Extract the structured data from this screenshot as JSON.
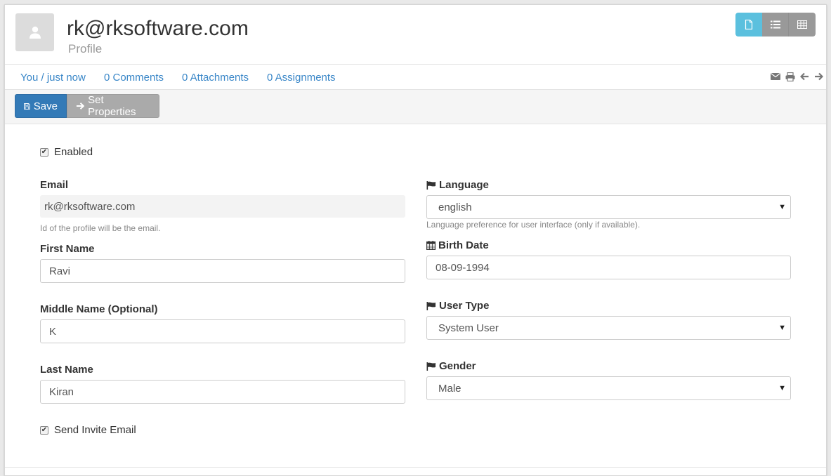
{
  "header": {
    "title": "rk@rksoftware.com",
    "subtitle": "Profile",
    "view_icons": [
      "file-icon",
      "list-icon",
      "table-icon"
    ]
  },
  "infobar": {
    "owner": "You / just now",
    "comments": "0 Comments",
    "attachments": "0 Attachments",
    "assignments": "0 Assignments",
    "icons": [
      "envelope-icon",
      "print-icon",
      "arrow-left-icon",
      "arrow-right-icon"
    ]
  },
  "toolbar": {
    "save_label": "Save",
    "set_properties_label": "Set Properties"
  },
  "form": {
    "enabled_label": "Enabled",
    "enabled_checked": true,
    "email_label": "Email",
    "email_value": "rk@rksoftware.com",
    "email_help": "Id of the profile will be the email.",
    "first_name_label": "First Name",
    "first_name_value": "Ravi",
    "middle_name_label": "Middle Name (Optional)",
    "middle_name_value": "K",
    "last_name_label": "Last Name",
    "last_name_value": "Kiran",
    "send_invite_label": "Send Invite Email",
    "send_invite_checked": true,
    "language_label": "Language",
    "language_value": "english",
    "language_help": "Language preference for user interface (only if available).",
    "birth_date_label": "Birth Date",
    "birth_date_value": "08-09-1994",
    "user_type_label": "User Type",
    "user_type_value": "System User",
    "gender_label": "Gender",
    "gender_value": "Male"
  },
  "colors": {
    "primary": "#337ab7",
    "link": "#3a87c8",
    "info": "#5bc0de",
    "grey_button": "#aaaaaa"
  }
}
